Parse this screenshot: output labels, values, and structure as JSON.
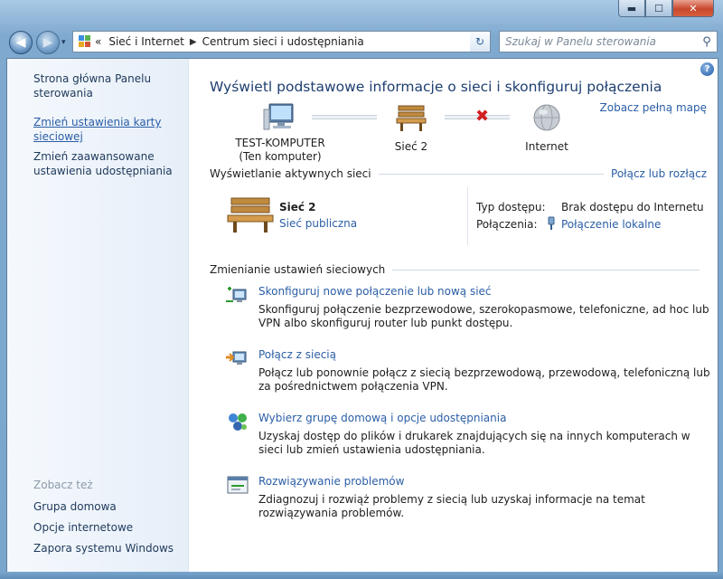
{
  "window": {
    "minimize": "▬",
    "maximize": "☐",
    "close": "✕"
  },
  "nav": {
    "back": "◀",
    "forward": "▶",
    "history": "▾",
    "chevrons": "«",
    "crumbs": [
      "Sieć i Internet",
      "Centrum sieci i udostępniania"
    ],
    "crumb_sep": "▶",
    "dropdown": "▾",
    "refresh": "↻",
    "search_placeholder": "Szukaj w Panelu sterowania",
    "search_icon": "search-icon"
  },
  "sidebar": {
    "home": "Strona główna Panelu sterowania",
    "links": [
      "Zmień ustawienia karty sieciowej",
      "Zmień zaawansowane ustawienia udostępniania"
    ],
    "see_also_title": "Zobacz też",
    "see_also": [
      "Grupa domowa",
      "Opcje internetowe",
      "Zapora systemu Windows"
    ]
  },
  "main": {
    "help": "?",
    "title": "Wyświetl podstawowe informacje o sieci i skonfiguruj połączenia",
    "full_map": "Zobacz pełną mapę",
    "map": {
      "computer_name": "TEST-KOMPUTER",
      "computer_sub": "(Ten komputer)",
      "network": "Sieć  2",
      "internet": "Internet",
      "broken_link": "✖"
    },
    "active_title": "Wyświetlanie aktywnych sieci",
    "connect_link": "Połącz lub rozłącz",
    "active": {
      "name": "Sieć  2",
      "type": "Sieć publiczna",
      "access_label": "Typ dostępu:",
      "access_value": "Brak dostępu do Internetu",
      "conn_label": "Połączenia:",
      "conn_value": "Połączenie lokalne"
    },
    "change_title": "Zmienianie ustawień sieciowych",
    "tasks": [
      {
        "title": "Skonfiguruj nowe połączenie lub nową sieć",
        "desc": "Skonfiguruj połączenie bezprzewodowe, szerokopasmowe, telefoniczne, ad hoc lub VPN albo skonfiguruj router lub punkt dostępu."
      },
      {
        "title": "Połącz z siecią",
        "desc": "Połącz lub ponownie połącz z siecią bezprzewodową, przewodową, telefoniczną lub za pośrednictwem połączenia VPN."
      },
      {
        "title": "Wybierz grupę domową i opcje udostępniania",
        "desc": "Uzyskaj dostęp do plików i drukarek znajdujących się na innych komputerach w sieci lub zmień ustawienia udostępniania."
      },
      {
        "title": "Rozwiązywanie problemów",
        "desc": "Zdiagnozuj i rozwiąż problemy z siecią lub uzyskaj informacje na temat rozwiązywania problemów."
      }
    ]
  },
  "colors": {
    "link": "#2b5ea6",
    "title": "#1e3f70",
    "error": "#d31f1f"
  }
}
